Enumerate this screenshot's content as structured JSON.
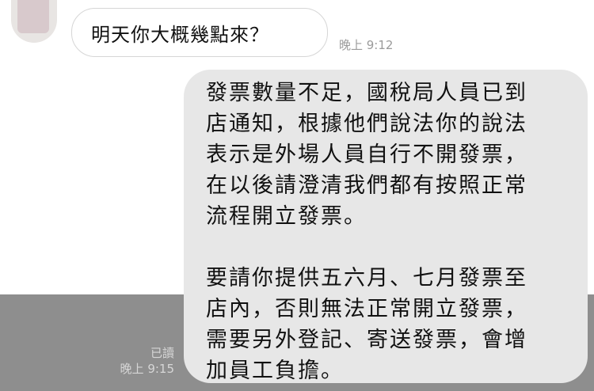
{
  "incoming": {
    "text": "明天你大概幾點來？",
    "time": "晚上 9:12"
  },
  "outgoing": {
    "lines": [
      "發票數量不足，國稅局人員已到",
      "店通知，根據他們說法你的說法",
      "表示是外場人員自行不開發票，",
      "在以後請澄清我們都有按照正常",
      "流程開立發票。",
      "",
      "要請你提供五六月、七月發票至",
      "店內，否則無法正常開立發票，",
      "需要另外登記、寄送發票，會增",
      "加員工負擔。"
    ],
    "read_status": "已讀",
    "time": "晚上 9:15"
  }
}
